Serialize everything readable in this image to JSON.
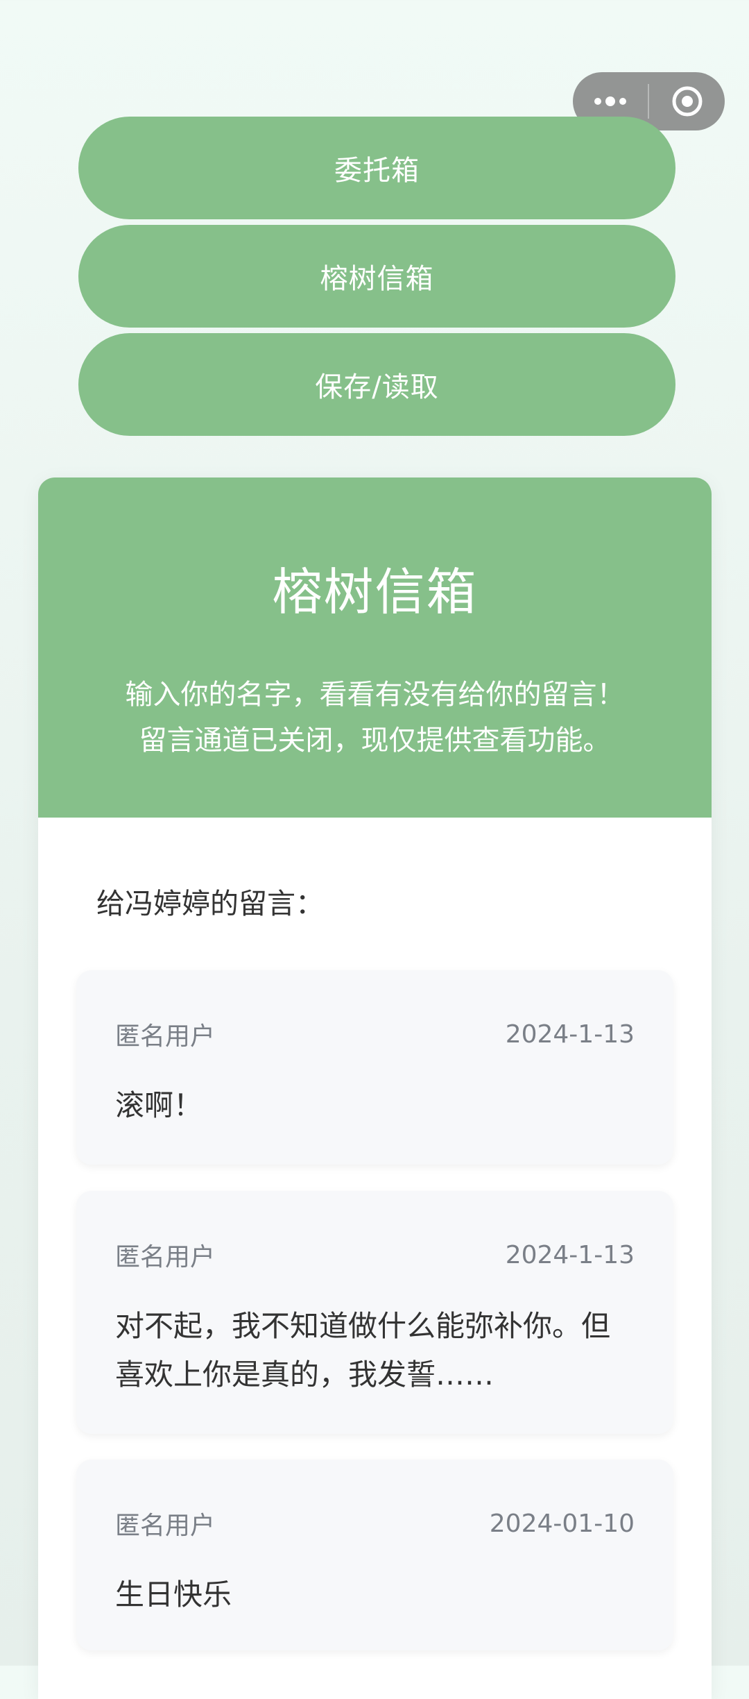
{
  "capsule": {
    "more_icon": "more-dots-icon",
    "target_icon": "target-circle-icon"
  },
  "menu": {
    "btn1": "委托箱",
    "btn2": "榕树信箱",
    "btn3": "保存/读取"
  },
  "card": {
    "title": "榕树信箱",
    "desc_line1": "输入你的名字，看看有没有给你的留言！",
    "desc_line2": "留言通道已关闭，现仅提供查看功能。",
    "section_title": "给冯婷婷的留言："
  },
  "messages": [
    {
      "author": "匿名用户",
      "date": "2024-1-13",
      "text": "滚啊！"
    },
    {
      "author": "匿名用户",
      "date": "2024-1-13",
      "text": "对不起，我不知道做什么能弥补你。但喜欢上你是真的，我发誓……"
    },
    {
      "author": "匿名用户",
      "date": "2024-01-10",
      "text": "生日快乐"
    }
  ],
  "colors": {
    "accent": "#86c08a",
    "background": "#f1faf6",
    "card": "#ffffff",
    "message_bg": "#f7f8fa"
  }
}
